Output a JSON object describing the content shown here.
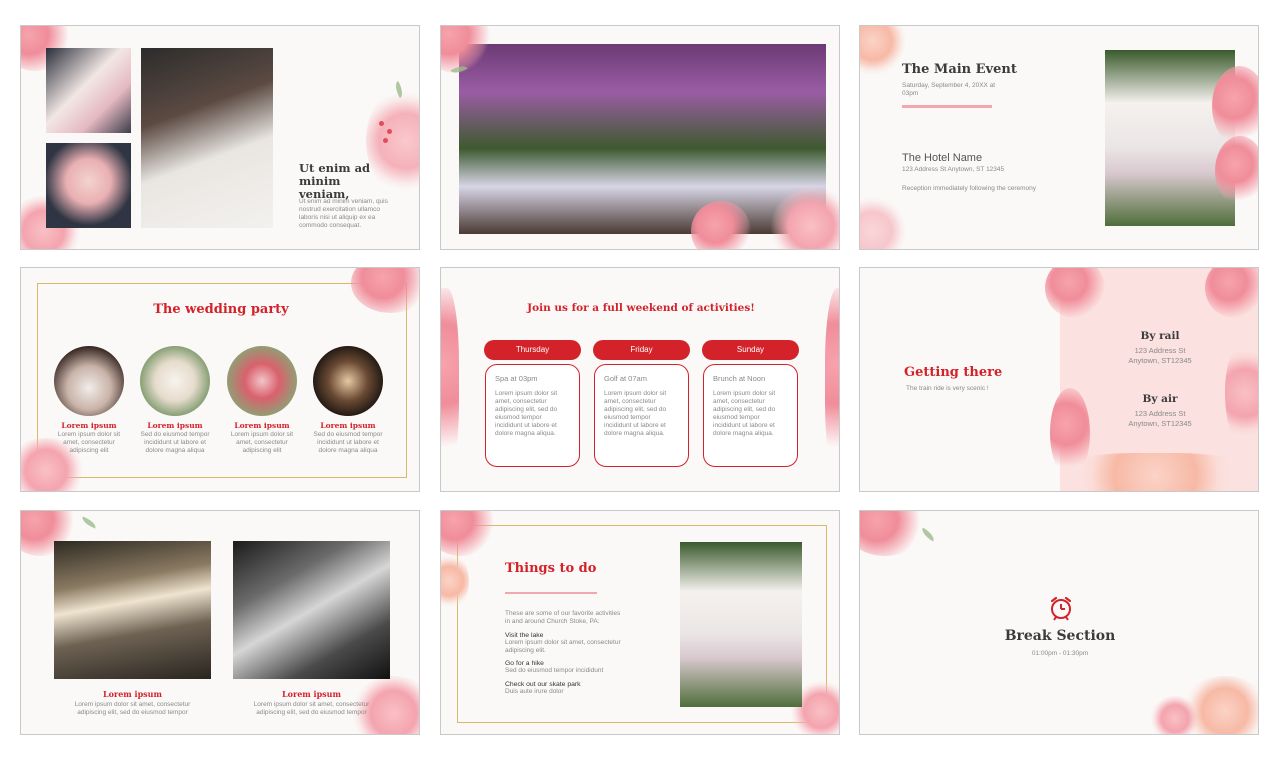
{
  "slide1": {
    "heading": "Ut enim ad minim veniam,",
    "body": "Ut enim ad minim veniam, quis nostrud exercitation ullamco laboris nisi ut aliquip ex ea commodo consequat."
  },
  "slide3": {
    "title": "The Main Event",
    "date": "Saturday, September 4, 20XX at 03pm",
    "venue": "The Hotel Name",
    "address": "123 Address St Anytown, ST 12345",
    "note": "Reception immediately following the ceremony"
  },
  "slide4": {
    "title": "The wedding party",
    "members": [
      {
        "name": "Lorem ipsum",
        "desc": "Lorem ipsum dolor sit amet, consectetur adipiscing elit"
      },
      {
        "name": "Lorem ipsum",
        "desc": "Sed do eiusmod tempor incididunt ut labore et dolore magna aliqua"
      },
      {
        "name": "Lorem ipsum",
        "desc": "Lorem ipsum dolor sit amet, consectetur adipiscing elit"
      },
      {
        "name": "Lorem ipsum",
        "desc": "Sed do eiusmod tempor incididunt ut labore et dolore magna aliqua"
      }
    ]
  },
  "slide5": {
    "title": "Join us for a full weekend of activities!",
    "days": [
      {
        "day": "Thursday",
        "time": "Spa at 03pm",
        "body": "Lorem ipsum dolor sit amet, consectetur adipiscing elit, sed do eiusmod tempor incididunt ut labore et dolore magna aliqua."
      },
      {
        "day": "Friday",
        "time": "Golf at 07am",
        "body": "Lorem ipsum dolor sit amet, consectetur adipiscing elit, sed do eiusmod tempor incididunt ut labore et dolore magna aliqua."
      },
      {
        "day": "Sunday",
        "time": "Brunch at Noon",
        "body": "Lorem ipsum dolor sit amet, consectetur adipiscing elit, sed do eiusmod tempor incididunt ut labore et dolore magna aliqua."
      }
    ]
  },
  "slide6": {
    "title": "Getting there",
    "subtitle": "The train ride is very scenic !",
    "rail_title": "By rail",
    "rail_line1": "123 Address St",
    "rail_line2": "Anytown, ST12345",
    "air_title": "By air",
    "air_line1": "123 Address St",
    "air_line2": "Anytown, ST12345"
  },
  "slide7": {
    "left_title": "Lorem ipsum",
    "left_body": "Lorem ipsum dolor sit amet, consectetur adipiscing elit, sed do eiusmod tempor",
    "right_title": "Lorem ipsum",
    "right_body": "Lorem ipsum dolor sit amet, consectetur adipiscing elit, sed do eiusmod tempor"
  },
  "slide8": {
    "title": "Things to do",
    "intro": "These are some of our favorite activities in and around Church Stoke, PA:",
    "items": [
      {
        "title": "Visit the lake",
        "body": "Lorem ipsum dolor sit amet, consectetur adipiscing elit."
      },
      {
        "title": "Go for a hike",
        "body": "Sed do eiusmod tempor incididunt"
      },
      {
        "title": "Check out our skate park",
        "body": "Duis aute irure dolor"
      }
    ]
  },
  "slide9": {
    "title": "Break Section",
    "time": "01:00pm - 01:30pm"
  },
  "icons": {
    "clock": "alarm-clock-icon"
  },
  "colors": {
    "accent": "#d3222a",
    "pink": "#f4a4ae",
    "gold": "#d8b86a"
  }
}
